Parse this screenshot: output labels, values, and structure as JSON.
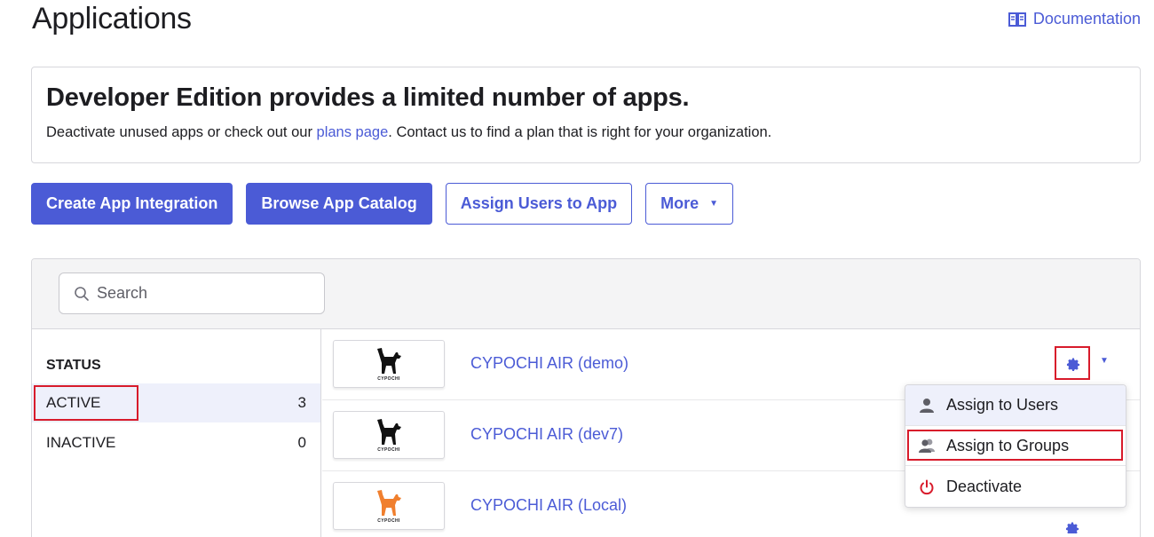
{
  "header": {
    "title": "Applications",
    "doc_link": "Documentation"
  },
  "banner": {
    "title": "Developer Edition provides a limited number of apps.",
    "text_before": "Deactivate unused apps or check out our ",
    "link": "plans page",
    "text_after": ". Contact us to find a plan that is right for your organization."
  },
  "actions": {
    "create": "Create App Integration",
    "browse": "Browse App Catalog",
    "assign": "Assign Users to App",
    "more": "More"
  },
  "search": {
    "placeholder": "Search"
  },
  "filters": {
    "status_label": "STATUS",
    "items": [
      {
        "label": "ACTIVE",
        "count": "3"
      },
      {
        "label": "INACTIVE",
        "count": "0"
      }
    ]
  },
  "apps": [
    {
      "name": "CYPOCHI AIR (demo)",
      "logo_text": "CYPOCHI",
      "logo_color": "#111111"
    },
    {
      "name": "CYPOCHI AIR (dev7)",
      "logo_text": "CYPOCHI",
      "logo_color": "#111111"
    },
    {
      "name": "CYPOCHI AIR (Local)",
      "logo_text": "CYPOCHI",
      "logo_color": "#f07f2e"
    }
  ],
  "menu": {
    "assign_users": "Assign to Users",
    "assign_groups": "Assign to Groups",
    "deactivate": "Deactivate"
  },
  "colors": {
    "accent": "#4b5bd6",
    "highlight": "#d81b2b",
    "danger": "#d81b2b"
  }
}
